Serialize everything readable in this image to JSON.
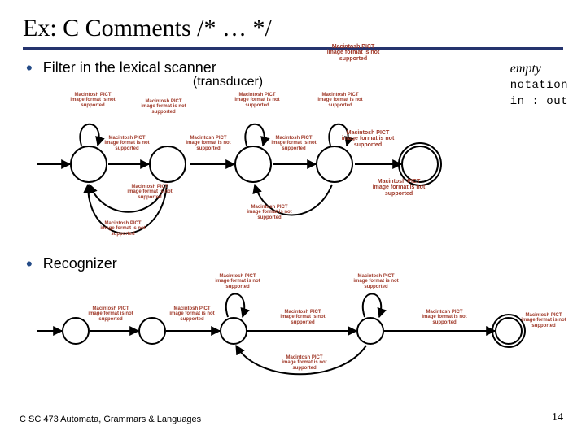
{
  "title": "Ex: C Comments  /*  …  */",
  "bullet1": "Filter in the lexical scanner",
  "sublabel": "(transducer)",
  "legend": {
    "empty": "empty",
    "notation1": "notation",
    "notation2": "in : out"
  },
  "bullet2": "Recognizer",
  "footer": "C SC 473 Automata, Grammars & Languages",
  "page_number": "14",
  "broken_text_small": "Macintosh PICT image format is not supported",
  "broken_text_big": "Macintosh PICT image format is not supported"
}
